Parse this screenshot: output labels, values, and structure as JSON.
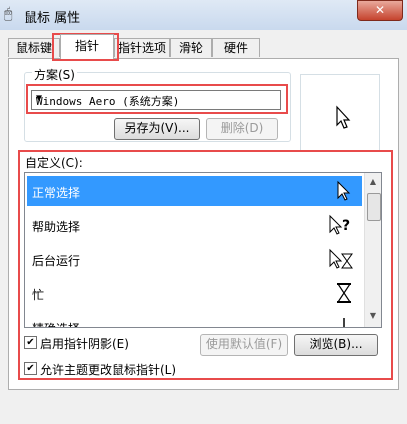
{
  "window": {
    "title": "鼠标 属性",
    "close_label": "✕"
  },
  "tabs": [
    {
      "label": "鼠标键"
    },
    {
      "label": "指针"
    },
    {
      "label": "指针选项"
    },
    {
      "label": "滑轮"
    },
    {
      "label": "硬件"
    }
  ],
  "scheme": {
    "label": "方案(S)",
    "selected": "Windows Aero (系统方案)",
    "save_as_label": "另存为(V)...",
    "delete_label": "删除(D)"
  },
  "custom": {
    "label": "自定义(C):",
    "items": [
      {
        "label": "正常选择"
      },
      {
        "label": "帮助选择"
      },
      {
        "label": "后台运行"
      },
      {
        "label": "忙"
      },
      {
        "label": "精确选择"
      }
    ]
  },
  "options": {
    "shadow_label": "启用指针阴影(E)",
    "shadow_checked": "✔",
    "default_label": "使用默认值(F)",
    "browse_label": "浏览(B)...",
    "theme_label": "允许主题更改鼠标指针(L)",
    "theme_checked": "✔"
  },
  "colors": {
    "highlight": "#e84b4b",
    "selection": "#3399ff"
  }
}
